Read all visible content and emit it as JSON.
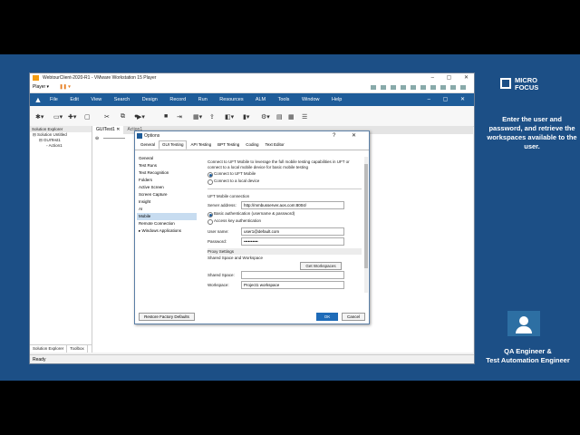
{
  "vmware": {
    "title": "WebtourClient-2020-R1 - VMware Workstation 15 Player",
    "player_label": "Player ▾",
    "controls": "– ▢ ✕"
  },
  "uft": {
    "menu": [
      "File",
      "Edit",
      "View",
      "Search",
      "Design",
      "Record",
      "Run",
      "Resources",
      "ALM",
      "Tools",
      "Window",
      "Help"
    ],
    "menu_controls": "– ▢ ✕",
    "tabs": {
      "active": "GUITest1",
      "inactive": "Action1"
    },
    "solution": {
      "header": "Solution Explorer",
      "items": [
        "Solution Untitled",
        "GUITest1",
        "Action1"
      ],
      "bottom_tabs": [
        "Solution Explorer",
        "Toolbox"
      ]
    },
    "status": "Ready"
  },
  "dialog": {
    "title": "Options",
    "controls": "? ✕",
    "tabs": [
      "General",
      "GUI Testing",
      "API Testing",
      "BPT Testing",
      "Coding",
      "Text Editor"
    ],
    "nav": [
      "General",
      "Test Runs",
      "Text Recognition",
      "Folders",
      "Active Screen",
      "Screen Capture",
      "Insight",
      "AI",
      "Mobile",
      "Remote Connection",
      "▸ Windows Applications"
    ],
    "description": "Connect to UFT Mobile to leverage the full mobile testing capabilities in UFT or connect to a local mobile device for basic mobile testing",
    "radio_connect": [
      "Connect to UFT Mobile",
      "Connect to a local device"
    ],
    "section_title": "UFT Mobile connection",
    "server_label": "Server address:",
    "server_value": "http://mmbusserver.aos.com:8004/",
    "auth": [
      "Basic authentication (username & password)",
      "Access key authentication"
    ],
    "user_label": "User name:",
    "user_value": "user1@default.com",
    "password_label": "Password:",
    "password_value": "••••••••••",
    "proxy": "Proxy Settings",
    "shared_title": "Shared Space and Workspace",
    "get_workspaces": "Get Workspaces",
    "shared_label": "Shared Space:",
    "workspace_label": "Workspace:",
    "workspace_value": "Project1 workspace",
    "restore": "Restore Factory Defaults",
    "ok": "OK",
    "cancel": "Cancel"
  },
  "panel": {
    "brand_line1": "MICRO",
    "brand_line2": "FOCUS",
    "instruction": "Enter the user and password, and retrieve the workspaces available to the user.",
    "role_line1": "QA Engineer &",
    "role_line2": "Test Automation Engineer"
  },
  "colors": {
    "slide_bg": "#1c4f86",
    "uft_menu": "#1e5c99"
  }
}
